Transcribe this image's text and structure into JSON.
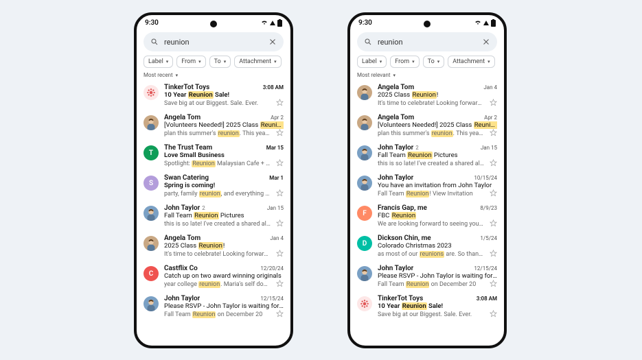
{
  "status": {
    "time": "9:30"
  },
  "search": {
    "query": "reunion"
  },
  "chips": {
    "label": "Label",
    "from": "From",
    "to": "To",
    "attachment": "Attachment"
  },
  "sort": {
    "recent": "Most recent",
    "relevant": "Most relevant"
  },
  "left": [
    {
      "avatar": {
        "type": "icon",
        "bg": "#fde7e7",
        "fg": "#e05757"
      },
      "sender": "TinkerTot Toys",
      "date": "3:08 AM",
      "dateBold": true,
      "bold": true,
      "subject": [
        [
          "t",
          "10 Year "
        ],
        [
          "h",
          "Reunion"
        ],
        [
          "t",
          " Sale!"
        ]
      ],
      "preview": [
        [
          "t",
          "Save big at our Biggest. Sale. Ever."
        ]
      ]
    },
    {
      "avatar": {
        "type": "photo",
        "bg": "#c9a884"
      },
      "sender": "Angela Tom",
      "date": "Apr 2",
      "subject": [
        [
          "t",
          "[Volunteers Needed!] 2025 Class "
        ],
        [
          "h",
          "Reunion"
        ]
      ],
      "preview": [
        [
          "t",
          "plan this summer's "
        ],
        [
          "h",
          "reunion"
        ],
        [
          "t",
          ". This year we're..."
        ]
      ]
    },
    {
      "avatar": {
        "type": "letter",
        "bg": "#0f9d58",
        "letter": "T"
      },
      "sender": "The Trust Team",
      "date": "Mar 15",
      "dateBold": true,
      "bold": true,
      "subject": [
        [
          "t",
          "Love Small Business"
        ]
      ],
      "preview": [
        [
          "t",
          "Spotlight: "
        ],
        [
          "h",
          "Reunion"
        ],
        [
          "t",
          " Malaysian Cafe + Kitch..."
        ]
      ]
    },
    {
      "avatar": {
        "type": "letter",
        "bg": "#b39ddb",
        "letter": "S"
      },
      "sender": "Swan Catering",
      "date": "Mar 1",
      "dateBold": true,
      "bold": true,
      "subject": [
        [
          "t",
          "Spring is coming!"
        ]
      ],
      "preview": [
        [
          "t",
          "party, family "
        ],
        [
          "h",
          "reunion"
        ],
        [
          "t",
          ", and everything in bet..."
        ]
      ]
    },
    {
      "avatar": {
        "type": "photo",
        "bg": "#7aa0c4"
      },
      "sender": "John Taylor",
      "threadCount": "2",
      "date": "Jan 15",
      "subject": [
        [
          "t",
          "Fall Team "
        ],
        [
          "h",
          "Reunion"
        ],
        [
          "t",
          " Pictures"
        ]
      ],
      "preview": [
        [
          "t",
          "this is so late!  I've created a shared album t..."
        ]
      ]
    },
    {
      "avatar": {
        "type": "photo",
        "bg": "#c9a884"
      },
      "sender": "Angela Tom",
      "date": "Jan 4",
      "subject": [
        [
          "t",
          "2025 Class "
        ],
        [
          "h",
          "Reunion"
        ],
        [
          "t",
          "!"
        ]
      ],
      "preview": [
        [
          "t",
          "It's time to celebrate!  Looking forward to se..."
        ]
      ]
    },
    {
      "avatar": {
        "type": "letter",
        "bg": "#ef5350",
        "letter": "C"
      },
      "sender": "Castflix Co",
      "date": "12/20/24",
      "subject": [
        [
          "t",
          "Catch up on two award winning originals"
        ]
      ],
      "preview": [
        [
          "t",
          "year college "
        ],
        [
          "h",
          "reunion"
        ],
        [
          "t",
          ". Maria's self doubt and..."
        ]
      ]
    },
    {
      "avatar": {
        "type": "photo",
        "bg": "#7aa0c4"
      },
      "sender": "John Taylor",
      "date": "12/15/24",
      "subject": [
        [
          "t",
          "Please RSVP - John Taylor is waiting for you..."
        ]
      ],
      "preview": [
        [
          "t",
          "Fall Team "
        ],
        [
          "h",
          "Reunion"
        ],
        [
          "t",
          " on December 20"
        ]
      ]
    }
  ],
  "right": [
    {
      "avatar": {
        "type": "photo",
        "bg": "#c9a884"
      },
      "sender": "Angela Tom",
      "date": "Jan 4",
      "subject": [
        [
          "t",
          "2025 Class "
        ],
        [
          "h",
          "Reunion"
        ],
        [
          "t",
          "!"
        ]
      ],
      "preview": [
        [
          "t",
          "It's time to celebrate!  Looking forward to se..."
        ]
      ]
    },
    {
      "avatar": {
        "type": "photo",
        "bg": "#c9a884"
      },
      "sender": "Angela Tom",
      "date": "Apr 2",
      "subject": [
        [
          "t",
          "[Volunteers Needed!] 2025 Class "
        ],
        [
          "h",
          "Reunion"
        ]
      ],
      "preview": [
        [
          "t",
          "plan this summer's "
        ],
        [
          "h",
          "reunion"
        ],
        [
          "t",
          ". This year we're..."
        ]
      ]
    },
    {
      "avatar": {
        "type": "photo",
        "bg": "#7aa0c4"
      },
      "sender": "John Taylor",
      "threadCount": "2",
      "date": "Jan 15",
      "subject": [
        [
          "t",
          "Fall Team "
        ],
        [
          "h",
          "Reunion"
        ],
        [
          "t",
          " Pictures"
        ]
      ],
      "preview": [
        [
          "t",
          "this is so late!  I've created a shared album t..."
        ]
      ]
    },
    {
      "avatar": {
        "type": "photo",
        "bg": "#7aa0c4"
      },
      "sender": "John Taylor",
      "date": "10/15/24",
      "subject": [
        [
          "t",
          "You have an invitation from John Taylor"
        ]
      ],
      "preview": [
        [
          "t",
          "Fall Team "
        ],
        [
          "h",
          "Reunion"
        ],
        [
          "t",
          "! View Invitation"
        ]
      ]
    },
    {
      "avatar": {
        "type": "letter",
        "bg": "#ff8a65",
        "letter": "F"
      },
      "sender": "Francis Gap, me",
      "date": "8/9/23",
      "subject": [
        [
          "t",
          "FBC "
        ],
        [
          "h",
          "Reunion"
        ]
      ],
      "preview": [
        [
          "t",
          "We are looking forward to seeing you!  Our..."
        ]
      ]
    },
    {
      "avatar": {
        "type": "letter",
        "bg": "#00bfa5",
        "letter": "D"
      },
      "sender": "Dickson Chin, me",
      "date": "1/5/24",
      "subject": [
        [
          "t",
          "Colorado Christmas 2023"
        ]
      ],
      "preview": [
        [
          "t",
          "as most of our "
        ],
        [
          "h",
          "reunions"
        ],
        [
          "t",
          " are.  So thankful for..."
        ]
      ]
    },
    {
      "avatar": {
        "type": "photo",
        "bg": "#7aa0c4"
      },
      "sender": "John Taylor",
      "date": "12/15/24",
      "subject": [
        [
          "t",
          "Please RSVP - John Taylor is waiting for you..."
        ]
      ],
      "preview": [
        [
          "t",
          "Fall Team "
        ],
        [
          "h",
          "Reunion"
        ],
        [
          "t",
          " on December 20"
        ]
      ]
    },
    {
      "avatar": {
        "type": "icon",
        "bg": "#fde7e7",
        "fg": "#e05757"
      },
      "sender": "TinkerTot Toys",
      "date": "3:08 AM",
      "dateBold": true,
      "bold": true,
      "subject": [
        [
          "t",
          "10 Year "
        ],
        [
          "h",
          "Reunion"
        ],
        [
          "t",
          " Sale!"
        ]
      ],
      "preview": [
        [
          "t",
          "Save big at our Biggest. Sale. Ever."
        ]
      ]
    }
  ]
}
